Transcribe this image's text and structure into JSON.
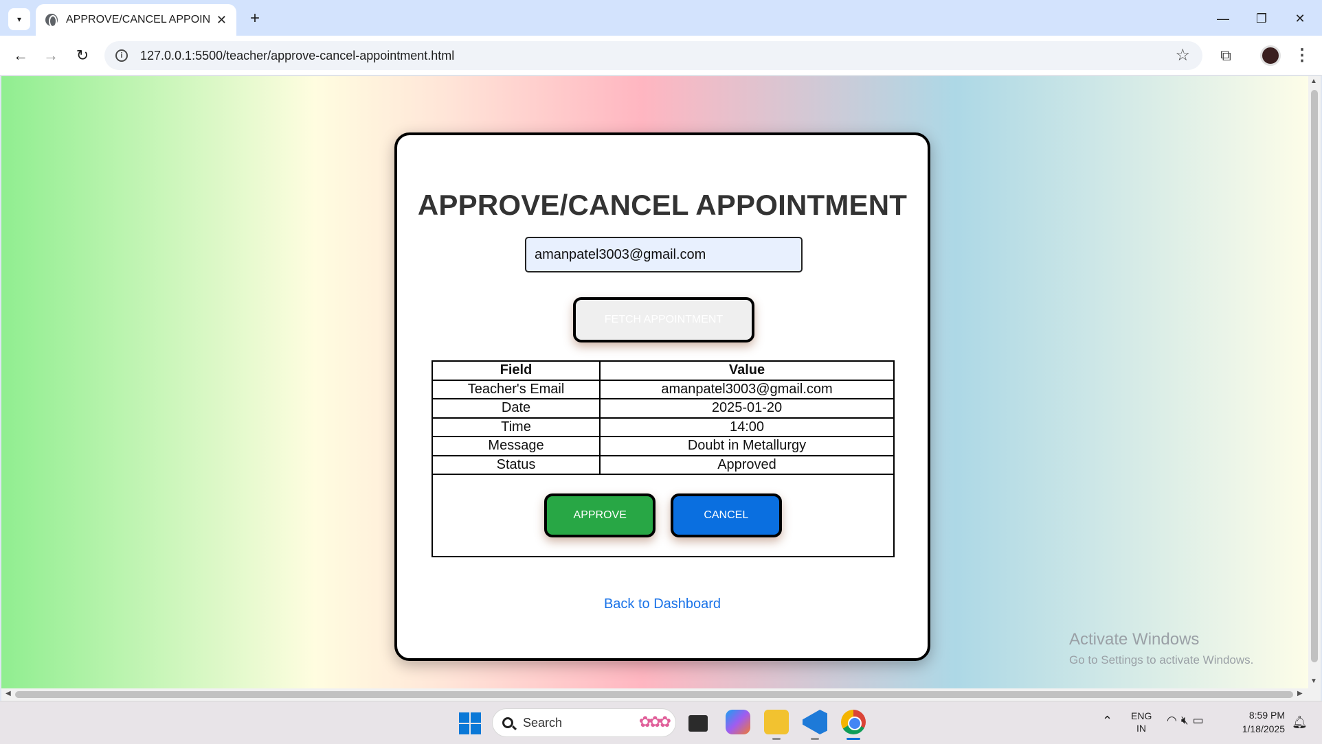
{
  "browser": {
    "tab_title": "APPROVE/CANCEL APPOINTME",
    "url": "127.0.0.1:5500/teacher/approve-cancel-appointment.html"
  },
  "page": {
    "title": "APPROVE/CANCEL APPOINTMENT",
    "email_value": "amanpatel3003@gmail.com",
    "fetch_label": "FETCH APPOINTMENT",
    "table": {
      "headers": [
        "Field",
        "Value"
      ],
      "rows": [
        [
          "Teacher's Email",
          "amanpatel3003@gmail.com"
        ],
        [
          "Date",
          "2025-01-20"
        ],
        [
          "Time",
          "14:00"
        ],
        [
          "Message",
          "Doubt in Metallurgy"
        ],
        [
          "Status",
          "Approved"
        ]
      ]
    },
    "approve_label": "APPROVE",
    "cancel_label": "CANCEL",
    "back_link": "Back to Dashboard"
  },
  "watermark": {
    "title": "Activate Windows",
    "subtitle": "Go to Settings to activate Windows."
  },
  "taskbar": {
    "search_label": "Search",
    "lang_line1": "ENG",
    "lang_line2": "IN",
    "time": "8:59 PM",
    "date": "1/18/2025"
  },
  "colors": {
    "approve": "#28a745",
    "cancel": "#0a6fe0",
    "link": "#1a73e8"
  }
}
